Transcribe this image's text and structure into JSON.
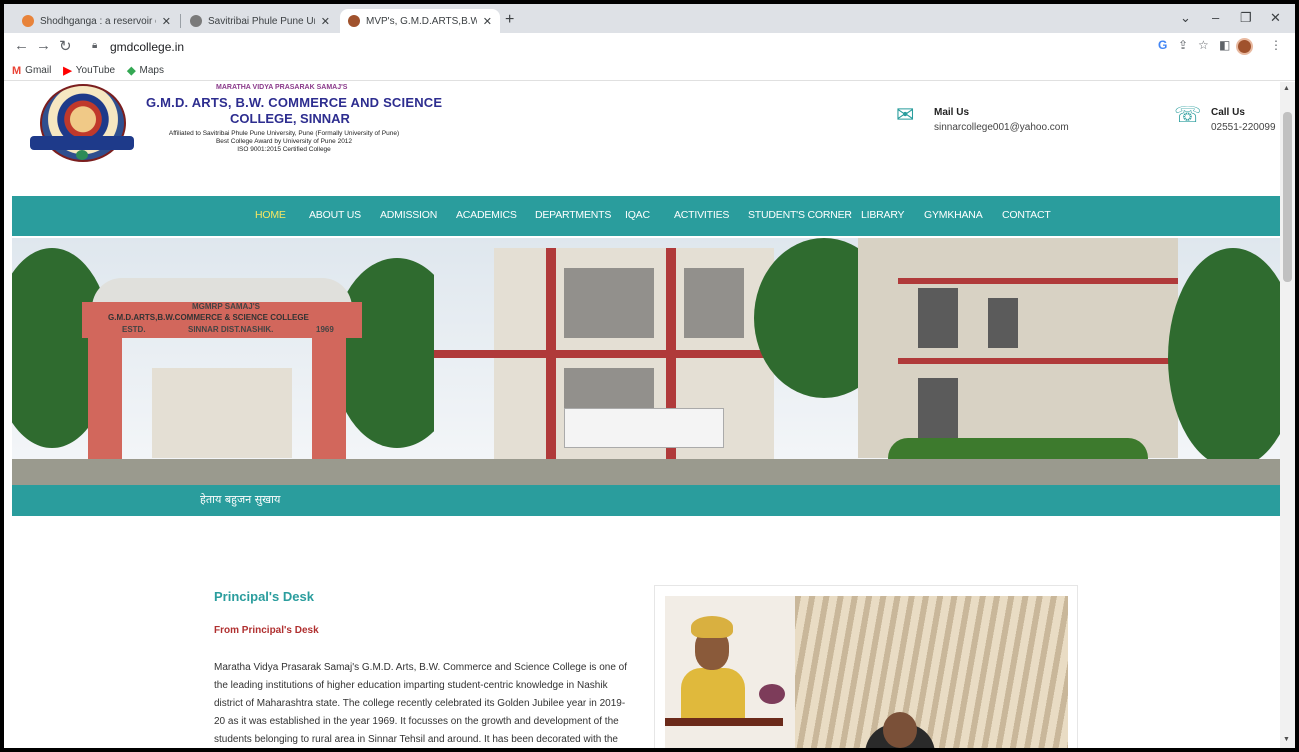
{
  "browser": {
    "tabs": [
      {
        "title": "Shodhganga : a reservoir of Indi",
        "active": false
      },
      {
        "title": "Savitribai Phule Pune University, ",
        "active": false
      },
      {
        "title": "MVP's, G.M.D.ARTS,B.W.COMME",
        "active": true
      }
    ],
    "url": "gmdcollege.in",
    "bookmarks": [
      {
        "label": "Gmail",
        "icon": "gmail-icon"
      },
      {
        "label": "YouTube",
        "icon": "youtube-icon"
      },
      {
        "label": "Maps",
        "icon": "maps-icon"
      }
    ]
  },
  "header": {
    "org": "MARATHA VIDYA PRASARAK SAMAJ'S",
    "college_line1": "G.M.D. ARTS, B.W. COMMERCE AND SCIENCE",
    "college_line2": "COLLEGE, SINNAR",
    "affiliation": [
      "Affiliated to Savitribai Phule Pune University, Pune (Formally University of Pune)",
      "Best College Award by University of Pune 2012",
      "ISO 9001:2015 Certified College"
    ],
    "mail_title": "Mail Us",
    "mail_value": "sinnarcollege001@yahoo.com",
    "call_title": "Call Us",
    "call_value": "02551-220099"
  },
  "nav": {
    "items": [
      "HOME",
      "ABOUT US",
      "ADMISSION",
      "ACADEMICS",
      "DEPARTMENTS",
      "IQAC",
      "ACTIVITIES",
      "STUDENT'S CORNER",
      "LIBRARY",
      "GYMKHANA",
      "CONTACT"
    ],
    "active": "HOME"
  },
  "banner": {
    "arch_text_1": "MGMRP SAMAJ'S",
    "arch_text_2": "G.M.D.ARTS,B.W.COMMERCE & SCIENCE COLLEGE",
    "arch_text_3": "SINNAR DIST.NASHIK.",
    "arch_estd": "ESTD.",
    "arch_year": "1969"
  },
  "tagline": "हेताय बहुजन सुखाय",
  "principal": {
    "heading": "Principal's Desk",
    "subheading": "From Principal's Desk",
    "paragraph": "Maratha Vidya Prasarak Samaj's G.M.D. Arts, B.W. Commerce and Science College is one of the leading institutions of higher education imparting student-centric knowledge in Nashik district of Maharashtra state. The college recently celebrated its Golden Jubilee year in 2019-20 as it was established in the year 1969. It focusses on the growth and development of the students belonging to rural area in Sinnar Tehsil and around. It has been decorated with the best college award in rural"
  },
  "colors": {
    "teal": "#2a9d9d",
    "navy": "#2d2d8f",
    "heading_red": "#b03030",
    "active_nav": "#f5e663"
  }
}
